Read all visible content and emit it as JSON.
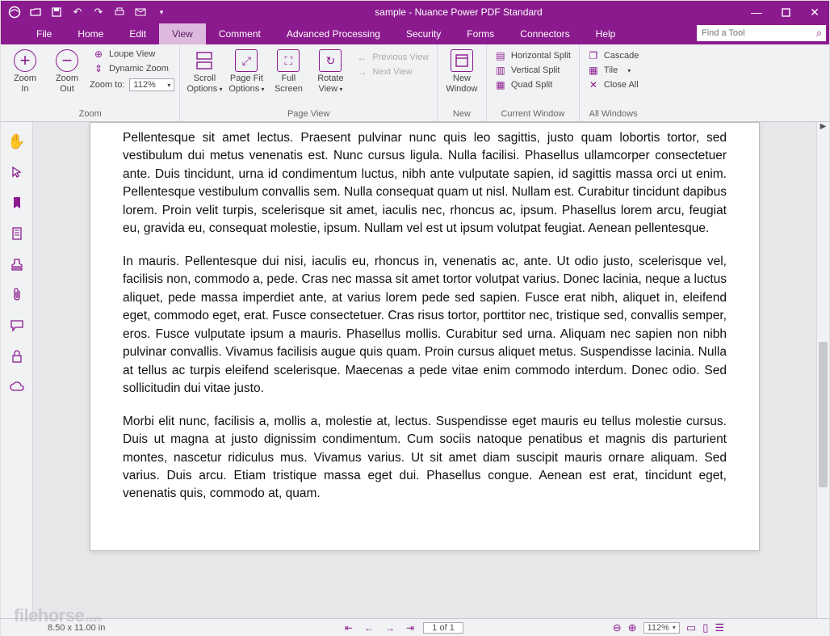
{
  "title": "sample - Nuance Power PDF Standard",
  "tabs": {
    "file": "File",
    "home": "Home",
    "edit": "Edit",
    "view": "View",
    "comment": "Comment",
    "advanced": "Advanced Processing",
    "security": "Security",
    "forms": "Forms",
    "connectors": "Connectors",
    "help": "Help"
  },
  "search": {
    "placeholder": "Find a Tool"
  },
  "ribbon": {
    "zoom": {
      "zoom_in": "Zoom\nIn",
      "zoom_out": "Zoom\nOut",
      "loupe": "Loupe View",
      "dynamic": "Dynamic Zoom",
      "zoom_to": "Zoom to:",
      "zoom_val": "112%",
      "group": "Zoom"
    },
    "page_view": {
      "scroll": "Scroll\nOptions",
      "pagefit": "Page Fit\nOptions",
      "full": "Full\nScreen",
      "rotate": "Rotate\nView",
      "prev": "Previous View",
      "next": "Next View",
      "group": "Page View"
    },
    "new": {
      "newwin": "New\nWindow",
      "group": "New"
    },
    "current": {
      "hsplit": "Horizontal Split",
      "vsplit": "Vertical Split",
      "qsplit": "Quad Split",
      "group": "Current Window"
    },
    "all": {
      "cascade": "Cascade",
      "tile": "Tile",
      "closeall": "Close All",
      "group": "All Windows"
    }
  },
  "document": {
    "p1": "Pellentesque sit amet lectus. Praesent pulvinar nunc quis leo sagittis, justo quam lobortis tortor, sed vestibulum dui metus venenatis est. Nunc cursus ligula. Nulla facilisi. Phasellus ullamcorper consectetuer ante. Duis tincidunt, urna id condimentum luctus, nibh ante vulputate sapien, id sagittis massa orci ut enim. Pellentesque vestibulum convallis sem. Nulla consequat quam ut nisl. Nullam est. Curabitur tincidunt dapibus lorem. Proin velit turpis, scelerisque sit amet, iaculis nec, rhoncus ac, ipsum. Phasellus lorem arcu, feugiat eu, gravida eu, consequat molestie, ipsum. Nullam vel est ut ipsum volutpat feugiat. Aenean pellentesque.",
    "p2": "In mauris. Pellentesque dui nisi, iaculis eu, rhoncus in, venenatis ac, ante. Ut odio justo, scelerisque vel, facilisis non, commodo a, pede. Cras nec massa sit amet tortor volutpat varius. Donec lacinia, neque a luctus aliquet, pede massa imperdiet ante, at varius lorem pede sed sapien. Fusce erat nibh, aliquet in, eleifend eget, commodo eget, erat. Fusce consectetuer. Cras risus tortor, porttitor nec, tristique sed, convallis semper, eros. Fusce vulputate ipsum a mauris. Phasellus mollis. Curabitur sed urna. Aliquam nec sapien non nibh pulvinar convallis. Vivamus facilisis augue quis quam. Proin cursus aliquet metus. Suspendisse lacinia. Nulla at tellus ac turpis eleifend scelerisque. Maecenas a pede vitae enim commodo interdum. Donec odio. Sed sollicitudin dui vitae justo.",
    "p3": "Morbi elit nunc, facilisis a, mollis a, molestie at, lectus. Suspendisse eget mauris eu tellus molestie cursus. Duis ut magna at justo dignissim condimentum. Cum sociis natoque penatibus et magnis dis parturient montes, nascetur ridiculus mus. Vivamus varius. Ut sit amet diam suscipit mauris ornare aliquam. Sed varius. Duis arcu. Etiam tristique massa eget dui. Phasellus congue. Aenean est erat, tincidunt eget, venenatis quis, commodo at, quam."
  },
  "status": {
    "dims": "8.50 x 11.00 in",
    "page": "1 of 1",
    "zoom": "112%"
  },
  "watermark": {
    "main": "filehorse",
    "tld": ".com"
  }
}
